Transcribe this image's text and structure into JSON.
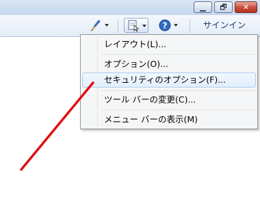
{
  "window": {
    "minimize_glyph": "▁",
    "maximize_glyph": "🗗",
    "close_glyph": "✕"
  },
  "toolbar": {
    "brush_icon": "paint-brush-icon",
    "page_icon": "page-cursor-icon",
    "help_icon": "help-icon",
    "signin_label": "サインイン"
  },
  "menu": {
    "items": [
      {
        "label": "レイアウト(L)..."
      },
      {
        "label": "オプション(O)..."
      },
      {
        "label": "セキュリティのオプション(F)..."
      },
      {
        "label": "ツール バーの変更(C)..."
      },
      {
        "label": "メニュー バーの表示(M)"
      }
    ]
  },
  "colors": {
    "annotation_line": "#e01010",
    "menu_highlight": "#aecbf0"
  }
}
